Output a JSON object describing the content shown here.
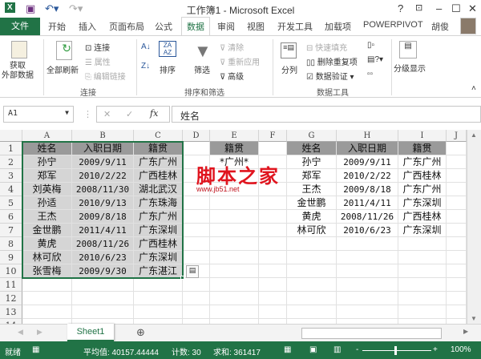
{
  "title": "工作簿1 - Microsoft Excel",
  "user": "胡俊",
  "tabs": [
    "文件",
    "开始",
    "插入",
    "页面布局",
    "公式",
    "数据",
    "审阅",
    "视图",
    "开发工具",
    "加载项",
    "POWERPIVOT"
  ],
  "ribbon": {
    "get_external": "获取\n外部数据",
    "refresh_all": "全部刷新",
    "connections": "连接",
    "properties": "属性",
    "edit_links": "编辑链接",
    "sort": "排序",
    "filter": "筛选",
    "clear": "清除",
    "reapply": "重新应用",
    "advanced": "高级",
    "text_to_columns": "分列",
    "flash_fill": "快速填充",
    "remove_dup": "删除重复项",
    "data_validation": "数据验证",
    "outline": "分级显示",
    "groups": {
      "connections": "连接",
      "sort_filter": "排序和筛选",
      "data_tools": "数据工具"
    }
  },
  "name_box": "A1",
  "formula": "姓名",
  "columns": [
    "A",
    "B",
    "C",
    "D",
    "E",
    "F",
    "G",
    "H",
    "I",
    "J"
  ],
  "rows": [
    "1",
    "2",
    "3",
    "4",
    "5",
    "6",
    "7",
    "8",
    "9",
    "10",
    "11",
    "12",
    "13",
    "14"
  ],
  "source_headers": [
    "姓名",
    "入职日期",
    "籍贯"
  ],
  "source": [
    [
      "孙宁",
      "2009/9/11",
      "广东广州"
    ],
    [
      "郑军",
      "2010/2/22",
      "广西桂林"
    ],
    [
      "刘英梅",
      "2008/11/30",
      "湖北武汉"
    ],
    [
      "孙适",
      "2010/9/13",
      "广东珠海"
    ],
    [
      "王杰",
      "2009/8/18",
      "广东广州"
    ],
    [
      "金世鹏",
      "2011/4/11",
      "广东深圳"
    ],
    [
      "黄虎",
      "2008/11/26",
      "广西桂林"
    ],
    [
      "林可欣",
      "2010/6/23",
      "广东深圳"
    ],
    [
      "张雪梅",
      "2009/9/30",
      "广东湛江"
    ]
  ],
  "criteria_header": "籍贯",
  "criteria_value": "*广州*",
  "result_headers": [
    "姓名",
    "入职日期",
    "籍贯"
  ],
  "result": [
    [
      "孙宁",
      "2009/9/11",
      "广东广州"
    ],
    [
      "郑军",
      "2010/2/22",
      "广西桂林"
    ],
    [
      "王杰",
      "2009/8/18",
      "广东广州"
    ],
    [
      "金世鹏",
      "2011/4/11",
      "广东深圳"
    ],
    [
      "黄虎",
      "2008/11/26",
      "广西桂林"
    ],
    [
      "林可欣",
      "2010/6/23",
      "广东深圳"
    ]
  ],
  "watermark": {
    "title": "脚本之家",
    "url": "www.jb51.net"
  },
  "sheet_tab": "Sheet1",
  "status": {
    "ready": "就绪",
    "average": "平均值: 40157.44444",
    "count": "计数: 30",
    "sum": "求和: 361417",
    "zoom": "100%"
  }
}
